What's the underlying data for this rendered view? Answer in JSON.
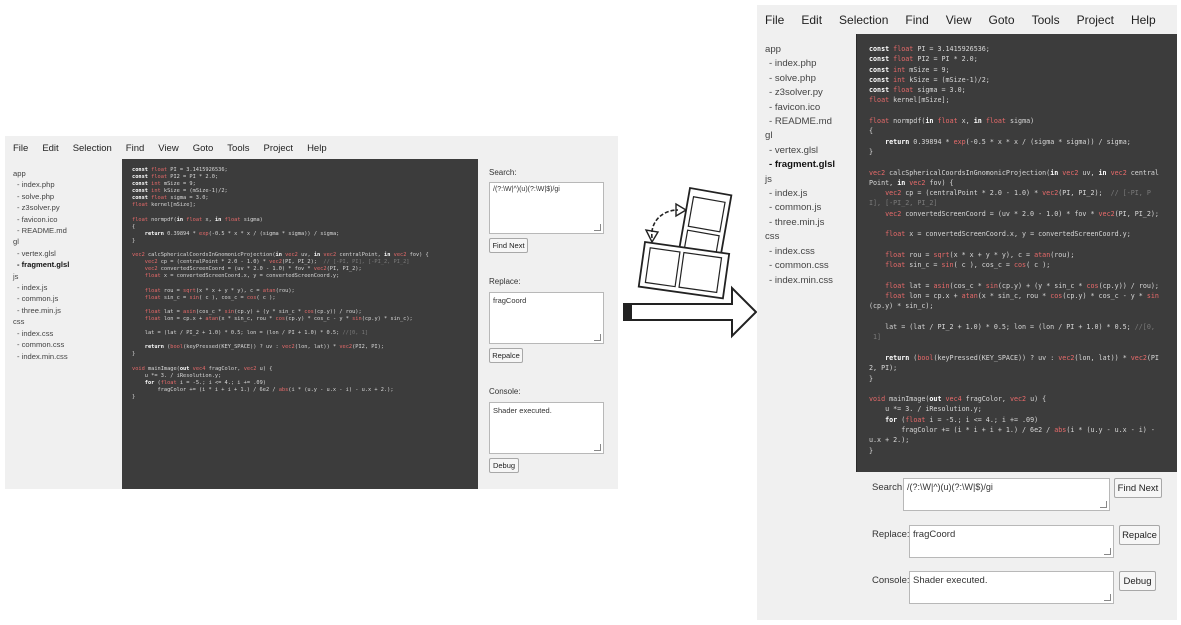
{
  "menu": [
    "File",
    "Edit",
    "Selection",
    "Find",
    "View",
    "Goto",
    "Tools",
    "Project",
    "Help"
  ],
  "tree": [
    {
      "label": "app",
      "kind": "folder"
    },
    {
      "label": "- index.php",
      "kind": "file"
    },
    {
      "label": "- solve.php",
      "kind": "file"
    },
    {
      "label": "- z3solver.py",
      "kind": "file"
    },
    {
      "label": "- favicon.ico",
      "kind": "file"
    },
    {
      "label": "- README.md",
      "kind": "file"
    },
    {
      "label": "gl",
      "kind": "folder"
    },
    {
      "label": "- vertex.glsl",
      "kind": "file"
    },
    {
      "label": "- fragment.glsl",
      "kind": "selected"
    },
    {
      "label": "js",
      "kind": "folder"
    },
    {
      "label": "- index.js",
      "kind": "file"
    },
    {
      "label": "- common.js",
      "kind": "file"
    },
    {
      "label": "- three.min.js",
      "kind": "file"
    },
    {
      "label": "css",
      "kind": "folder"
    },
    {
      "label": "- index.css",
      "kind": "file"
    },
    {
      "label": "- common.css",
      "kind": "file"
    },
    {
      "label": "- index.min.css",
      "kind": "file"
    }
  ],
  "code_small": [
    "<k>const</k> <t>float</t> PI = 3.1415926536;",
    "<k>const</k> <t>float</t> PI2 = PI * 2.0;",
    "<k>const</k> <t>int</t> mSize = 9;",
    "<k>const</k> <t>int</t> kSize = (mSize-1)/2;",
    "<k>const</k> <t>float</t> sigma = 3.0;",
    "<t>float</t> kernel[mSize];",
    "",
    "<t>float</t> normpdf(<k>in</k> <t>float</t> x, <k>in</k> <t>float</t> sigma)",
    "{",
    "    <k>return</k> 0.39894 * <f>exp</f>(-0.5 * x * x / (sigma * sigma)) / sigma;",
    "}",
    "",
    "<t>vec2</t> calcSphericalCoordsInGnomonicProjection(<k>in</k> <t>vec2</t> uv, <k>in</k> <t>vec2</t> centralPoint, <k>in</k> <t>vec2</t> fov) {",
    "    <t>vec2</t> cp = (centralPoint * 2.0 - 1.0) * <t>vec2</t>(PI, PI_2);  <c>// [-PI, PI], [-PI_2, PI_2]</c>",
    "    <t>vec2</t> convertedScreenCoord = (uv * 2.0 - 1.0) * fov * <t>vec2</t>(PI, PI_2);",
    "    <t>float</t> x = convertedScreenCoord.x, y = convertedScreenCoord.y;",
    "",
    "    <t>float</t> rou = <f>sqrt</f>(x * x + y * y), c = <f>atan</f>(rou);",
    "    <t>float</t> sin_c = <f>sin</f>( c ), cos_c = <f>cos</f>( c );",
    "",
    "    <t>float</t> lat = <f>asin</f>(cos_c * <f>sin</f>(cp.y) + (y * sin_c * <f>cos</f>(cp.y)) / rou);",
    "    <t>float</t> lon = cp.x + <f>atan</f>(x * sin_c, rou * <f>cos</f>(cp.y) * cos_c - y * <f>sin</f>(cp.y) * sin_c);",
    "",
    "    lat = (lat / PI_2 + 1.0) * 0.5; lon = (lon / PI + 1.0) * 0.5; <c>//[0, 1]</c>",
    "",
    "    <k>return</k> (<f>bool</f>(keyPressed(KEY_SPACE)) ? uv : <t>vec2</t>(lon, lat)) * <t>vec2</t>(PI2, PI);",
    "}",
    "",
    "<t>void</t> mainImage(<k>out</k> <t>vec4</t> fragColor, <t>vec2</t> u) {",
    "    u *= 3. / iResolution.y;",
    "    <k>for</k> (<t>float</t> i = -5.; i <= 4.; i += .09)",
    "        fragColor += (i * i + i + 1.) / 6e2 / <f>abs</f>(i * (u.y - u.x - i) - u.x + 2.);",
    "}"
  ],
  "code_large": [
    "<k>const</k> <t>float</t> PI = 3.1415926536;",
    "<k>const</k> <t>float</t> PI2 = PI * 2.0;",
    "<k>const</k> <t>int</t> mSize = 9;",
    "<k>const</k> <t>int</t> kSize = (mSize-1)/2;",
    "<k>const</k> <t>float</t> sigma = 3.0;",
    "<t>float</t> kernel[mSize];",
    "",
    "<t>float</t> normpdf(<k>in</k> <t>float</t> x, <k>in</k> <t>float</t> sigma)",
    "{",
    "    <k>return</k> 0.39894 * <f>exp</f>(-0.5 * x * x / (sigma * sigma)) / sigma;",
    "}",
    "",
    "<t>vec2</t> calcSphericalCoordsInGnomonicProjection(<k>in</k> <t>vec2</t> uv, <k>in</k> <t>vec2</t> central",
    "Point, <k>in</k> <t>vec2</t> fov) {",
    "    <t>vec2</t> cp = (centralPoint * 2.0 - 1.0) * <t>vec2</t>(PI, PI_2);  <c>// [-PI, P</c>",
    "<c>I], [-PI_2, PI_2]</c>",
    "    <t>vec2</t> convertedScreenCoord = (uv * 2.0 - 1.0) * fov * <t>vec2</t>(PI, PI_2);",
    "",
    "    <t>float</t> x = convertedScreenCoord.x, y = convertedScreenCoord.y;",
    "",
    "    <t>float</t> rou = <f>sqrt</f>(x * x + y * y), c = <f>atan</f>(rou);",
    "    <t>float</t> sin_c = <f>sin</f>( c ), cos_c = <f>cos</f>( c );",
    "",
    "    <t>float</t> lat = <f>asin</f>(cos_c * <f>sin</f>(cp.y) + (y * sin_c * <f>cos</f>(cp.y)) / rou);",
    "    <t>float</t> lon = cp.x + <f>atan</f>(x * sin_c, rou * <f>cos</f>(cp.y) * cos_c - y * <f>sin</f>",
    "(cp.y) * sin_c);",
    "",
    "    lat = (lat / PI_2 + 1.0) * 0.5; lon = (lon / PI + 1.0) * 0.5; <c>//[0,</c>",
    "<c> 1]</c>",
    "",
    "    <k>return</k> (<f>bool</f>(keyPressed(KEY_SPACE)) ? uv : <t>vec2</t>(lon, lat)) * <t>vec2</t>(PI",
    "2, PI);",
    "}",
    "",
    "<t>void</t> mainImage(<k>out</k> <t>vec4</t> fragColor, <t>vec2</t> u) {",
    "    u *= 3. / iResolution.y;",
    "    <k>for</k> (<t>float</t> i = -5.; i <= 4.; i += .09)",
    "        fragColor += (i * i + i + 1.) / 6e2 / <f>abs</f>(i * (u.y - u.x - i) -",
    "u.x + 2.);",
    "}"
  ],
  "panel": {
    "search_label": "Search:",
    "search_value": "/(?:\\W|^)(u)(?:\\W|$)/gi",
    "find_next": "Find Next",
    "replace_label": "Replace:",
    "replace_value": "fragCoord",
    "replace_button": "Repalce",
    "console_label": "Console:",
    "console_value": "Shader executed.",
    "debug_button": "Debug"
  },
  "colors": {
    "editor_bg": "#3c3c3c",
    "window_bg": "#f0f0f0",
    "keyword": "#ffffff",
    "type": "#e86a6a",
    "comment": "#7a7a7a"
  }
}
